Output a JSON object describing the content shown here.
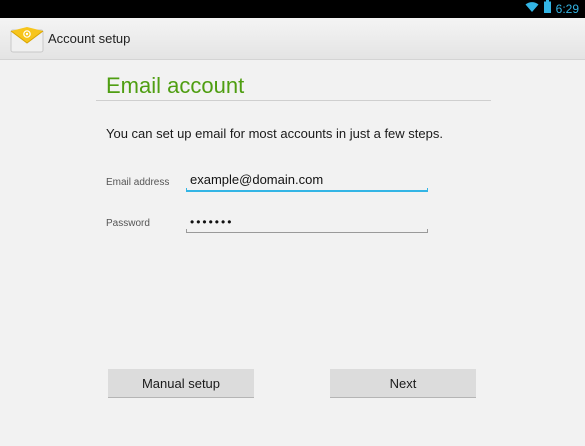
{
  "status_bar": {
    "time": "6:29",
    "wifi_icon": "wifi-icon",
    "battery_icon": "battery-icon"
  },
  "action_bar": {
    "app_icon": "email-envelope-icon",
    "title": "Account setup"
  },
  "main": {
    "heading": "Email account",
    "instructions": "You can set up email for most accounts in just a few steps.",
    "email_field": {
      "label": "Email address",
      "value": "example@domain.com"
    },
    "password_field": {
      "label": "Password",
      "value": "•••••••"
    }
  },
  "buttons": {
    "manual_setup": "Manual setup",
    "next": "Next"
  },
  "colors": {
    "accent": "#33b5e5",
    "heading": "#4f9e12"
  }
}
